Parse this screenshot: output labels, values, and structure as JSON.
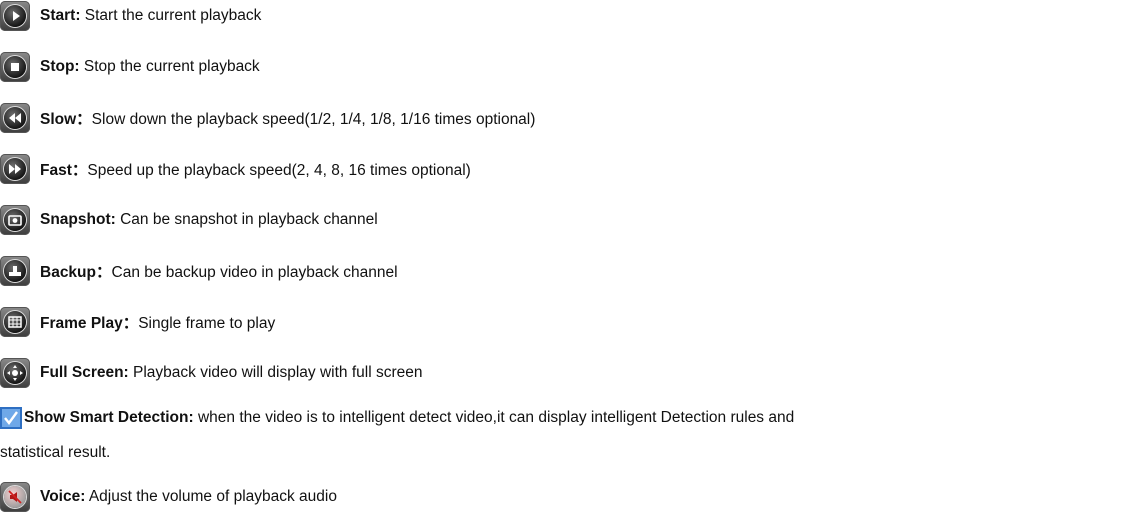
{
  "items": [
    {
      "icon": "play-icon",
      "title": "Start:",
      "desc": " Start the current playback"
    },
    {
      "icon": "stop-icon",
      "title": "Stop:",
      "desc": " Stop the current playback"
    },
    {
      "icon": "slow-icon",
      "title": "Slow：",
      "desc": "Slow down the playback speed(1/2, 1/4, 1/8, 1/16 times optional)"
    },
    {
      "icon": "fast-icon",
      "title": "Fast：",
      "desc": "Speed up the playback speed(2, 4, 8, 16 times optional)"
    },
    {
      "icon": "snapshot-icon",
      "title": "Snapshot:",
      "desc": " Can be snapshot in playback channel"
    },
    {
      "icon": "backup-icon",
      "title": "Backup：",
      "desc": "Can be backup video in playback channel"
    },
    {
      "icon": "frame-play-icon",
      "title": "Frame Play：",
      "desc": "Single frame to play"
    },
    {
      "icon": "full-screen-icon",
      "title": "Full Screen:",
      "desc": " Playback video will display with full screen"
    }
  ],
  "smart": {
    "icon": "checkbox-checked-icon",
    "title": "Show Smart Detection:",
    "desc": " when the video is to intelligent detect video,it can display intelligent Detection rules and",
    "desc2": "statistical result."
  },
  "voice": {
    "icon": "voice-icon",
    "title": "Voice:",
    "desc": " Adjust the volume of playback audio"
  }
}
